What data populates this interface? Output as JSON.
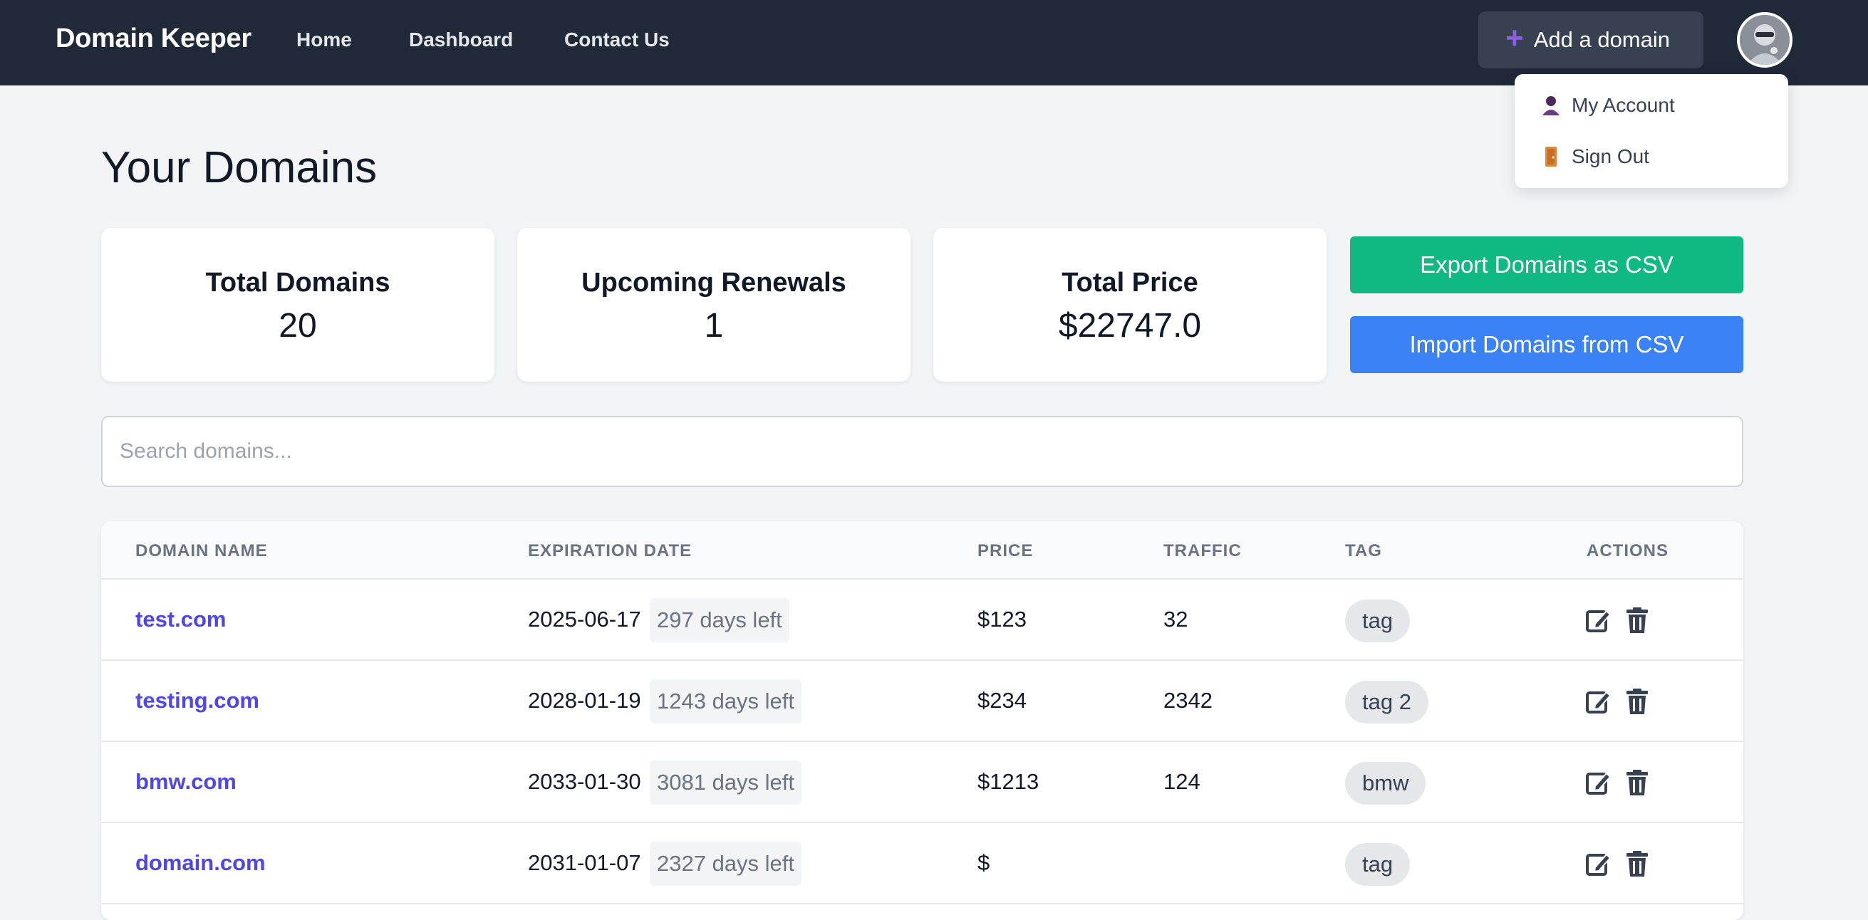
{
  "navbar": {
    "brand": "Domain Keeper",
    "links": [
      "Home",
      "Dashboard",
      "Contact Us"
    ],
    "add_domain_label": "Add a domain",
    "plus_glyph": "+"
  },
  "user_menu": {
    "items": [
      {
        "label": "My Account",
        "icon": "user-icon"
      },
      {
        "label": "Sign Out",
        "icon": "door-icon"
      }
    ]
  },
  "page_title": "Your Domains",
  "stats": [
    {
      "label": "Total Domains",
      "value": "20"
    },
    {
      "label": "Upcoming Renewals",
      "value": "1"
    },
    {
      "label": "Total Price",
      "value": "$22747.0"
    }
  ],
  "actions": {
    "export_label": "Export Domains as CSV",
    "import_label": "Import Domains from CSV",
    "export_color": "#10b981",
    "import_color": "#3b82f6"
  },
  "search": {
    "placeholder": "Search domains...",
    "value": ""
  },
  "table": {
    "headers": [
      "DOMAIN NAME",
      "EXPIRATION DATE",
      "PRICE",
      "TRAFFIC",
      "TAG",
      "ACTIONS"
    ],
    "rows": [
      {
        "name": "test.com",
        "expiration": "2025-06-17",
        "days_left": "297 days left",
        "price": "$123",
        "traffic": "32",
        "tag": "tag"
      },
      {
        "name": "testing.com",
        "expiration": "2028-01-19",
        "days_left": "1243 days left",
        "price": "$234",
        "traffic": "2342",
        "tag": "tag 2"
      },
      {
        "name": "bmw.com",
        "expiration": "2033-01-30",
        "days_left": "3081 days left",
        "price": "$1213",
        "traffic": "124",
        "tag": "bmw"
      },
      {
        "name": "domain.com",
        "expiration": "2031-01-07",
        "days_left": "2327 days left",
        "price": "$",
        "traffic": "",
        "tag": "tag"
      }
    ]
  },
  "colors": {
    "navbar_bg": "#1f2937",
    "accent_purple": "#8b5cf6",
    "link_indigo": "#4f46e5"
  }
}
